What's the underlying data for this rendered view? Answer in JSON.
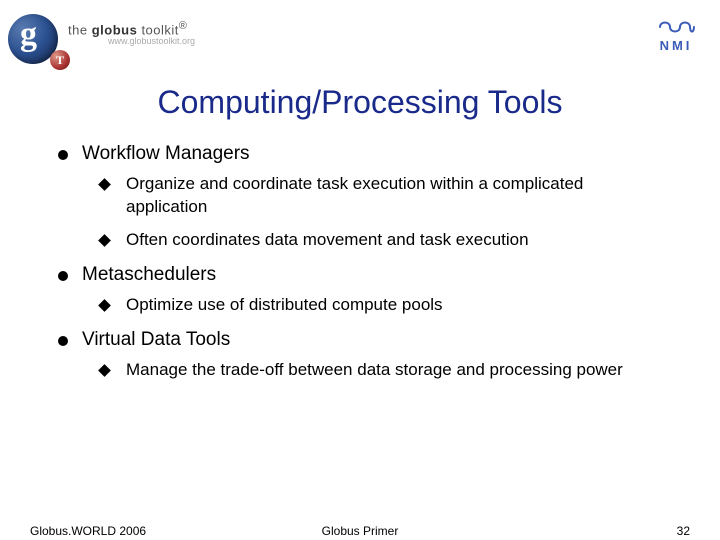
{
  "header": {
    "toolkit_text_a": "the",
    "toolkit_text_b": "globus",
    "toolkit_text_c": "toolkit",
    "toolkit_reg": "®",
    "url": "www.globustoolkit.org",
    "tdot": "T",
    "nmi": "NMI"
  },
  "title": "Computing/Processing Tools",
  "bullets": {
    "b1": "Workflow Managers",
    "b1_1": "Organize and coordinate task execution within a complicated application",
    "b1_2": "Often coordinates data movement and task execution",
    "b2": "Metaschedulers",
    "b2_1": "Optimize use of distributed compute pools",
    "b3": "Virtual Data Tools",
    "b3_1": "Manage the trade-off between data storage and processing power"
  },
  "footer": {
    "left": "Globus.WORLD 2006",
    "center": "Globus Primer",
    "right": "32"
  }
}
